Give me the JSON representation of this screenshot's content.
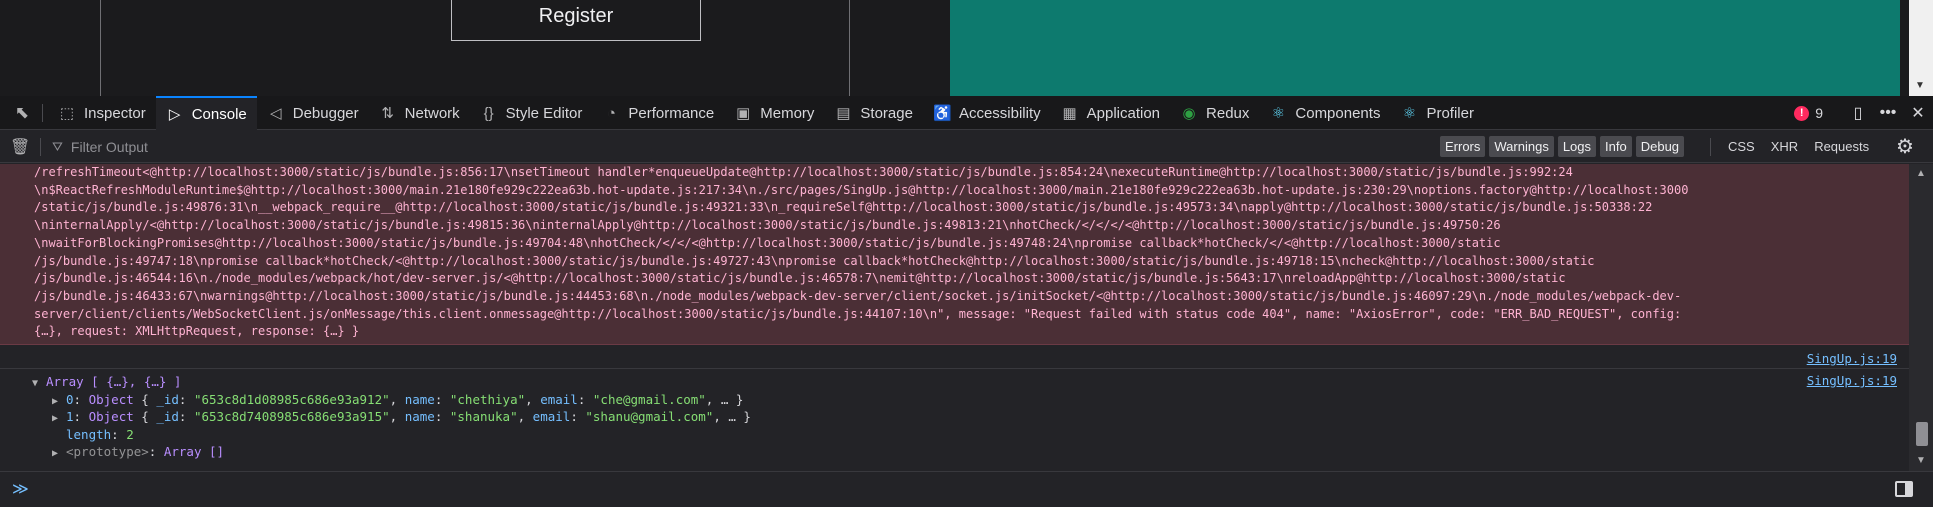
{
  "page": {
    "register_label": "Register"
  },
  "devtools": {
    "tabs": [
      {
        "label": "Inspector",
        "icon": "inspector-icon",
        "glyph": "⬚"
      },
      {
        "label": "Console",
        "icon": "console-icon",
        "glyph": "▷",
        "active": true
      },
      {
        "label": "Debugger",
        "icon": "debugger-icon",
        "glyph": "◁"
      },
      {
        "label": "Network",
        "icon": "network-icon",
        "glyph": "⇅"
      },
      {
        "label": "Style Editor",
        "icon": "style-editor-icon",
        "glyph": "{}"
      },
      {
        "label": "Performance",
        "icon": "performance-icon",
        "glyph": "◔"
      },
      {
        "label": "Memory",
        "icon": "memory-icon",
        "glyph": "▣"
      },
      {
        "label": "Storage",
        "icon": "storage-icon",
        "glyph": "▤"
      },
      {
        "label": "Accessibility",
        "icon": "accessibility-icon",
        "glyph": "♿"
      },
      {
        "label": "Application",
        "icon": "application-icon",
        "glyph": "▦"
      },
      {
        "label": "Redux",
        "icon": "redux-icon",
        "glyph": "◉"
      },
      {
        "label": "Components",
        "icon": "react-components-icon",
        "glyph": "⚛"
      },
      {
        "label": "Profiler",
        "icon": "react-profiler-icon",
        "glyph": "⚛"
      }
    ],
    "error_count": "9",
    "filter_placeholder": "Filter Output",
    "levels": [
      "Errors",
      "Warnings",
      "Logs",
      "Info",
      "Debug"
    ],
    "categories": [
      "CSS",
      "XHR",
      "Requests"
    ],
    "accent_color": "#0a84ff"
  },
  "console": {
    "error_lines": [
      "/refreshTimeout<@http://localhost:3000/static/js/bundle.js:856:17\\nsetTimeout handler*enqueueUpdate@http://localhost:3000/static/js/bundle.js:854:24\\nexecuteRuntime@http://localhost:3000/static/js/bundle.js:992:24",
      "\\n$ReactRefreshModuleRuntime$@http://localhost:3000/main.21e180fe929c222ea63b.hot-update.js:217:34\\n./src/pages/SingUp.js@http://localhost:3000/main.21e180fe929c222ea63b.hot-update.js:230:29\\noptions.factory@http://localhost:3000",
      "/static/js/bundle.js:49876:31\\n__webpack_require__@http://localhost:3000/static/js/bundle.js:49321:33\\n_requireSelf@http://localhost:3000/static/js/bundle.js:49573:34\\napply@http://localhost:3000/static/js/bundle.js:50338:22",
      "\\ninternalApply/<@http://localhost:3000/static/js/bundle.js:49815:36\\ninternalApply@http://localhost:3000/static/js/bundle.js:49813:21\\nhotCheck/</</</<@http://localhost:3000/static/js/bundle.js:49750:26",
      "\\nwaitForBlockingPromises@http://localhost:3000/static/js/bundle.js:49704:48\\nhotCheck/</</<@http://localhost:3000/static/js/bundle.js:49748:24\\npromise callback*hotCheck/</<@http://localhost:3000/static",
      "/js/bundle.js:49747:18\\npromise callback*hotCheck/<@http://localhost:3000/static/js/bundle.js:49727:43\\npromise callback*hotCheck@http://localhost:3000/static/js/bundle.js:49718:15\\ncheck@http://localhost:3000/static",
      "/js/bundle.js:46544:16\\n./node_modules/webpack/hot/dev-server.js/<@http://localhost:3000/static/js/bundle.js:46578:7\\nemit@http://localhost:3000/static/js/bundle.js:5643:17\\nreloadApp@http://localhost:3000/static",
      "/js/bundle.js:46433:67\\nwarnings@http://localhost:3000/static/js/bundle.js:44453:68\\n./node_modules/webpack-dev-server/client/socket.js/initSocket/<@http://localhost:3000/static/js/bundle.js:46097:29\\n./node_modules/webpack-dev-",
      "server/client/clients/WebSocketClient.js/onMessage/this.client.onmessage@http://localhost:3000/static/js/bundle.js:44107:10\\n\", message: \"Request failed with status code 404\", name: \"AxiosError\", code: \"ERR_BAD_REQUEST\", config:",
      "{…}, request: XMLHttpRequest, response: {…} }"
    ],
    "empty_log_location": "SingUp.js:19",
    "array_log": {
      "location": "SingUp.js:19",
      "summary": "Array [ {…}, {…} ]",
      "items": [
        {
          "index": "0",
          "type": "Object",
          "id": "\"653c8d1d08985c686e93a912\"",
          "name": "\"chethiya\"",
          "email": "\"che@gmail.com\""
        },
        {
          "index": "1",
          "type": "Object",
          "id": "\"653c8d7408985c686e93a915\"",
          "name": "\"shanuka\"",
          "email": "\"shanu@gmail.com\""
        }
      ],
      "length_key": "length",
      "length_value": "2",
      "prototype_key": "<prototype>",
      "prototype_value": "Array []"
    },
    "prompt": "≫"
  }
}
